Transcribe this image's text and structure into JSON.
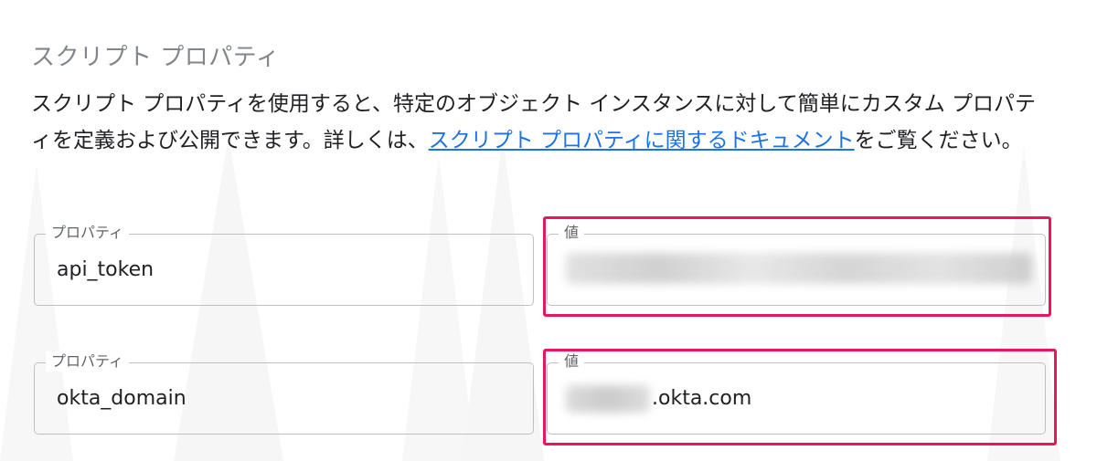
{
  "section": {
    "title": "スクリプト プロパティ",
    "description_before": "スクリプト プロパティを使用すると、特定のオブジェクト インスタンスに対して簡単にカスタム プロパティを定義および公開できます。詳しくは、",
    "link_text": "スクリプト プロパティに関するドキュメント",
    "description_after": "をご覧ください。"
  },
  "properties": [
    {
      "property_label": "プロパティ",
      "property_value": "api_token",
      "value_label": "値"
    },
    {
      "property_label": "プロパティ",
      "property_value": "okta_domain",
      "value_label": "値",
      "value_suffix": ".okta.com"
    }
  ],
  "colors": {
    "link": "#1a73e8",
    "highlight": "#e8175d",
    "title": "#80868b"
  }
}
